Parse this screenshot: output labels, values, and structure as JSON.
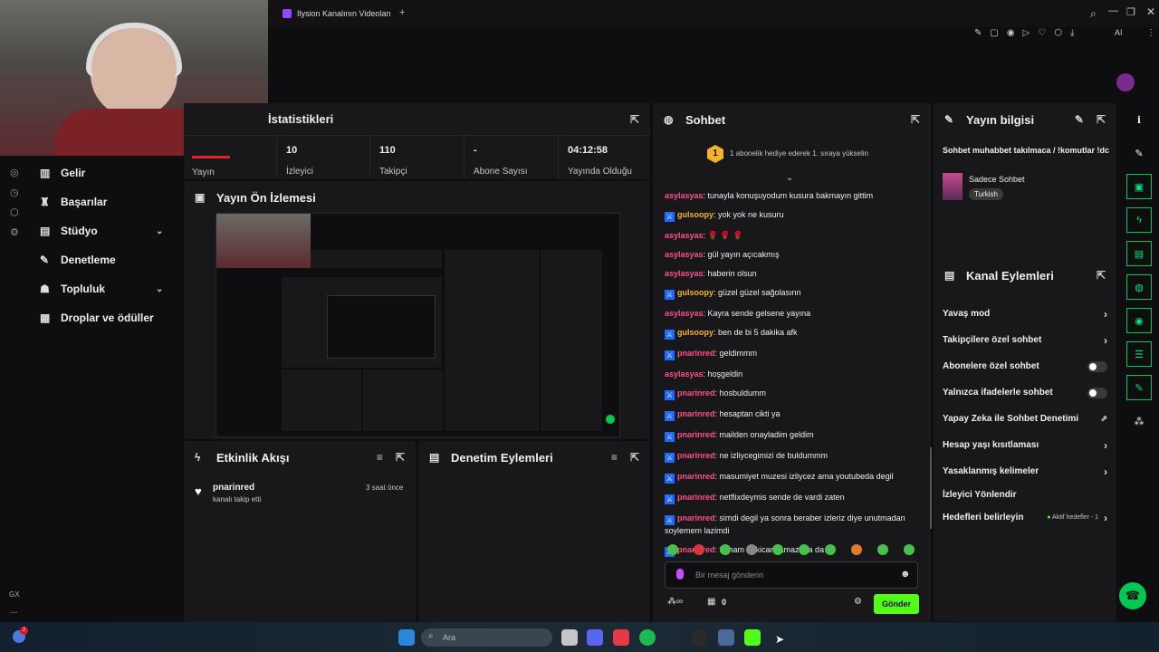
{
  "browser": {
    "tab_title": "Ilysion Kanalının Videoları",
    "new_tab": "+",
    "ai_label": "AI"
  },
  "sidebar": {
    "items": [
      {
        "label": "Gelir"
      },
      {
        "label": "Başarılar"
      },
      {
        "label": "Stüdyo"
      },
      {
        "label": "Denetleme"
      },
      {
        "label": "Topluluk"
      },
      {
        "label": "Droplar ve ödüller"
      }
    ],
    "rail_label": "GX",
    "rail_more": "..."
  },
  "stats": {
    "panel_title": "İstatistikleri",
    "items": [
      {
        "value": "10",
        "label": "İzleyici"
      },
      {
        "value": "110",
        "label": "Takipçi"
      },
      {
        "value": "-",
        "label": "Abone Sayısı"
      },
      {
        "value": "04:12:58",
        "label": "Yayında Olduğu"
      }
    ],
    "cut_label": "Yayın"
  },
  "preview": {
    "title": "Yayın Ön İzlemesi"
  },
  "activity": {
    "title": "Etkinlik Akışı",
    "events": [
      {
        "user": "pnarinred",
        "text": "kanalı takip etti",
        "time": "3 saat önce"
      }
    ]
  },
  "moderation": {
    "title": "Denetim Eylemleri"
  },
  "chat": {
    "title": "Sohbet",
    "gift_text": "1 abonelik hediye ederek 1. sıraya yükselin",
    "gift_rank": "1",
    "messages": [
      {
        "user": "asylasyas",
        "color": "pink",
        "badge": false,
        "text": ": tunayla konuşuyodum kusura bakmayın gittim"
      },
      {
        "user": "gulsoopy",
        "color": "gold",
        "badge": true,
        "text": ": yok yok ne kusuru"
      },
      {
        "user": "asylasyas",
        "color": "pink",
        "badge": false,
        "text": ": 🌹 🌹 🌹"
      },
      {
        "user": "asylasyas",
        "color": "pink",
        "badge": false,
        "text": ": gül yayın açıcakmış"
      },
      {
        "user": "asylasyas",
        "color": "pink",
        "badge": false,
        "text": ": haberin olsun"
      },
      {
        "user": "gulsoopy",
        "color": "gold",
        "badge": true,
        "text": ": güzel güzel sağolasınn"
      },
      {
        "user": "asylasyas",
        "color": "pink",
        "badge": false,
        "text": ": Kayra sende gelsene yayına"
      },
      {
        "user": "gulsoopy",
        "color": "gold",
        "badge": true,
        "text": ": ben de bi 5 dakika afk"
      },
      {
        "user": "pnarinred",
        "color": "pink",
        "badge": true,
        "text": ": geldimmm"
      },
      {
        "user": "asylasyas",
        "color": "pink",
        "badge": false,
        "text": ": hoşgeldin"
      },
      {
        "user": "pnarinred",
        "color": "pink",
        "badge": true,
        "text": ": hosbuldumm"
      },
      {
        "user": "pnarinred",
        "color": "pink",
        "badge": true,
        "text": ": hesaptan cikti ya"
      },
      {
        "user": "pnarinred",
        "color": "pink",
        "badge": true,
        "text": ": mailden onayladim geldim"
      },
      {
        "user": "pnarinred",
        "color": "pink",
        "badge": true,
        "text": ": ne izliycegimizi de buldummm"
      },
      {
        "user": "pnarinred",
        "color": "pink",
        "badge": true,
        "text": ": masumiyet muzesi izliycez ama youtubeda degil"
      },
      {
        "user": "pnarinred",
        "color": "pink",
        "badge": true,
        "text": ": netflixdeymis sende de vardi zaten"
      },
      {
        "user": "pnarinred",
        "color": "pink",
        "badge": true,
        "text": ": simdi degil ya sonra beraber izleriz diye unutmadan soylemem lazimdi"
      },
      {
        "user": "pnarinred",
        "color": "pink",
        "badge": true,
        "text": ": tamam bakicam amazona da"
      }
    ],
    "input_placeholder": "Bir mesaj gönderin",
    "points": "0",
    "send_label": "Gönder"
  },
  "stream_info": {
    "title": "Yayın bilgisi",
    "stream_title": "Sohbet muhabbet takılmaca / !komutlar !dc",
    "category": "Sadece Sohbet",
    "tag": "Turkish"
  },
  "channel_actions": {
    "title": "Kanal Eylemleri",
    "rows": [
      {
        "label": "Yavaş mod",
        "kind": "chevron"
      },
      {
        "label": "Takipçilere özel sohbet",
        "kind": "chevron"
      },
      {
        "label": "Abonelere özel sohbet",
        "kind": "toggle"
      },
      {
        "label": "Yalnızca ifadelerle sohbet",
        "kind": "toggle"
      },
      {
        "label": "Yapay Zeka ile Sohbet Denetimi",
        "kind": "external"
      },
      {
        "label": "Hesap yaşı kısıtlaması",
        "kind": "chevron"
      },
      {
        "label": "Yasaklanmış kelimeler",
        "kind": "chevron"
      },
      {
        "label": "İzleyici Yönlendir",
        "kind": "none"
      },
      {
        "label": "Hedefleri belirleyin",
        "kind": "goals"
      }
    ],
    "goal_status": "Aktif hedefler - 1"
  },
  "taskbar": {
    "search_placeholder": "Ara",
    "notif_count": "2"
  },
  "colors": {
    "accent": "#53fc18",
    "panel": "#18181b",
    "pink": "#ff4f88",
    "gold": "#f3b22a"
  }
}
